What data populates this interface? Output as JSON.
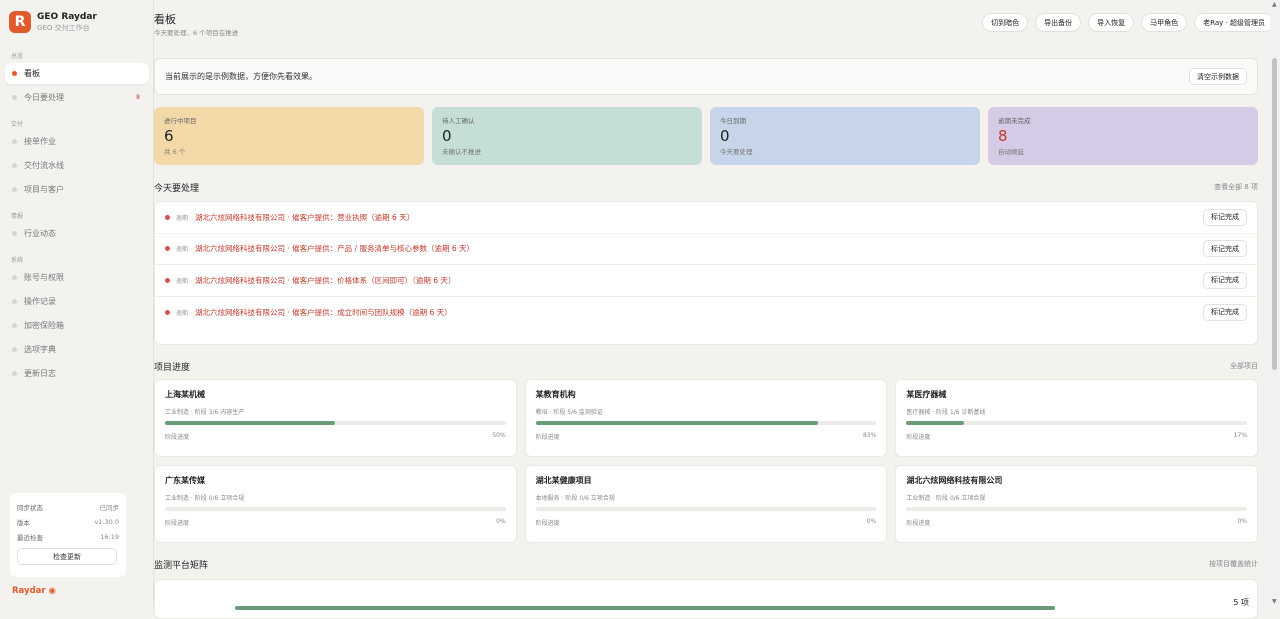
{
  "brand": {
    "name": "GEO Raydar",
    "sub": "GEO 交付工作台",
    "logo": "R"
  },
  "sidebar": {
    "sections": {
      "overview": "总览",
      "delivery": "交付",
      "intel": "情报",
      "system": "系统",
      "system_dot": "·"
    },
    "items": [
      {
        "label": "看板",
        "count": ""
      },
      {
        "label": "今日要处理",
        "count": "8"
      },
      {
        "label": "接单作业",
        "count": ""
      },
      {
        "label": "交付流水线",
        "count": ""
      },
      {
        "label": "项目与客户",
        "count": ""
      },
      {
        "label": "行业动态",
        "count": ""
      },
      {
        "label": "账号与权限",
        "count": ""
      },
      {
        "label": "操作记录",
        "count": ""
      },
      {
        "label": "加密保险箱",
        "count": ""
      },
      {
        "label": "选项字典",
        "count": ""
      },
      {
        "label": "更新日志",
        "count": ""
      }
    ],
    "sync": {
      "status_label": "同步状态",
      "status_value": "已同步",
      "version_label": "版本",
      "version_value": "v1.30.0",
      "check_label": "最近检查",
      "check_value": "16:19",
      "check_button": "检查更新"
    },
    "footer_logo": "Raydar"
  },
  "header": {
    "title": "看板",
    "subtitle": "今天要处理、6 个项目在推进",
    "buttons": [
      "切到暗色",
      "导出备份",
      "导入恢复",
      "马甲角色",
      "老Ray · 超级管理员"
    ]
  },
  "notice": {
    "text": "当前展示的是示例数据，方便你先看效果。",
    "button": "清空示例数据"
  },
  "stats": [
    {
      "label": "进行中项目",
      "value": "6",
      "sub": "共 6 个",
      "color": "#f3d9a8",
      "value_color": "#222"
    },
    {
      "label": "待人工确认",
      "value": "0",
      "sub": "未确认不推进",
      "color": "#c5ded6",
      "value_color": "#222"
    },
    {
      "label": "今日到期",
      "value": "0",
      "sub": "今天要处理",
      "color": "#c6d5e9",
      "value_color": "#222"
    },
    {
      "label": "逾期未完成",
      "value": "8",
      "sub": "自动顺延",
      "color": "#d5cbe6",
      "value_color": "#c0392b"
    }
  ],
  "todo": {
    "title": "今天要处理",
    "link": "查看全部 8 项",
    "items": [
      {
        "tag": "逾期",
        "text": "湖北六炫网络科技有限公司 · 催客户提供：营业执照（逾期 6 天）",
        "button": "标记完成"
      },
      {
        "tag": "逾期",
        "text": "湖北六炫网络科技有限公司 · 催客户提供：产品 / 服务清单与核心参数（逾期 6 天）",
        "button": "标记完成"
      },
      {
        "tag": "逾期",
        "text": "湖北六炫网络科技有限公司 · 催客户提供：价格体系（区间即可）（逾期 6 天）",
        "button": "标记完成"
      },
      {
        "tag": "逾期",
        "text": "湖北六炫网络科技有限公司 · 催客户提供：成立时间与团队规模（逾期 6 天）",
        "button": "标记完成"
      }
    ]
  },
  "progress": {
    "title": "项目进度",
    "link": "全部项目",
    "projects": [
      {
        "name": "上海某机械",
        "meta": "工业制造 · 阶段 3/6 内容生产",
        "label": "阶段进度",
        "pct": "50%",
        "value": 0.5
      },
      {
        "name": "某教育机构",
        "meta": "教培 · 阶段 5/6 监测验证",
        "label": "阶段进度",
        "pct": "83%",
        "value": 0.83
      },
      {
        "name": "某医疗器械",
        "meta": "医疗器械 · 阶段 1/6 诊断基线",
        "label": "阶段进度",
        "pct": "17%",
        "value": 0.17
      },
      {
        "name": "广东某传媒",
        "meta": "工业制造 · 阶段 0/6 立项合规",
        "label": "阶段进度",
        "pct": "0%",
        "value": 0
      },
      {
        "name": "湖北某健康项目",
        "meta": "本地服务 · 阶段 0/6 立项合规",
        "label": "阶段进度",
        "pct": "0%",
        "value": 0
      },
      {
        "name": "湖北六炫网络科技有限公司",
        "meta": "工业制造 · 阶段 0/6 立项合规",
        "label": "阶段进度",
        "pct": "0%",
        "value": 0
      }
    ]
  },
  "matrix": {
    "title": "监测平台矩阵",
    "link": "按项目覆盖统计",
    "count": "5 项"
  }
}
